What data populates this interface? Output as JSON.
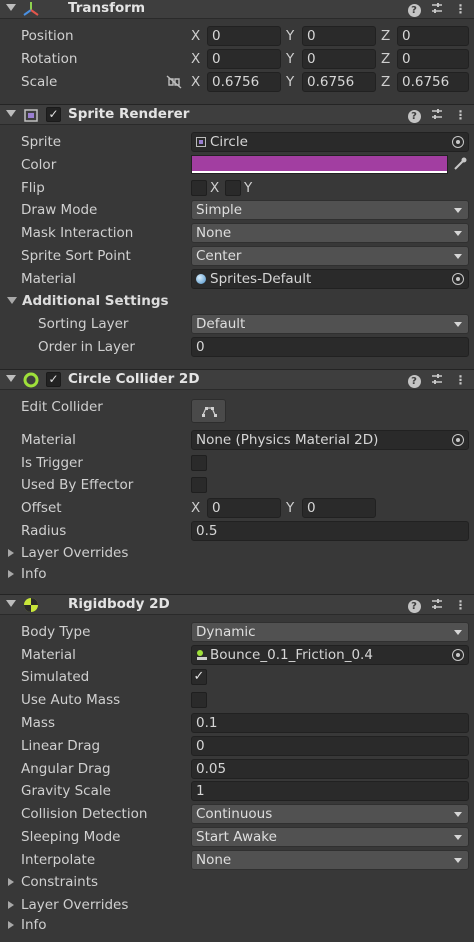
{
  "transform": {
    "title": "Transform",
    "position": {
      "label": "Position",
      "x": "0",
      "y": "0",
      "z": "0"
    },
    "rotation": {
      "label": "Rotation",
      "x": "0",
      "y": "0",
      "z": "0"
    },
    "scale": {
      "label": "Scale",
      "x": "0.6756",
      "y": "0.6756",
      "z": "0.6756"
    }
  },
  "axes": {
    "x": "X",
    "y": "Y",
    "z": "Z"
  },
  "sprite_renderer": {
    "title": "Sprite Renderer",
    "enabled": "✓",
    "sprite": {
      "label": "Sprite",
      "value": "Circle"
    },
    "color": {
      "label": "Color",
      "value": "#a23ea1"
    },
    "flip": {
      "label": "Flip",
      "x": "X",
      "y": "Y"
    },
    "draw_mode": {
      "label": "Draw Mode",
      "value": "Simple"
    },
    "mask_interaction": {
      "label": "Mask Interaction",
      "value": "None"
    },
    "sprite_sort_point": {
      "label": "Sprite Sort Point",
      "value": "Center"
    },
    "material": {
      "label": "Material",
      "value": "Sprites-Default"
    },
    "additional_settings": "Additional Settings",
    "sorting_layer": {
      "label": "Sorting Layer",
      "value": "Default"
    },
    "order_in_layer": {
      "label": "Order in Layer",
      "value": "0"
    }
  },
  "circle_collider": {
    "title": "Circle Collider 2D",
    "enabled": "✓",
    "edit_collider": "Edit Collider",
    "material": {
      "label": "Material",
      "value": "None (Physics Material 2D)"
    },
    "is_trigger": "Is Trigger",
    "used_by_effector": "Used By Effector",
    "offset": {
      "label": "Offset",
      "x": "0",
      "y": "0"
    },
    "radius": {
      "label": "Radius",
      "value": "0.5"
    },
    "layer_overrides": "Layer Overrides",
    "info": "Info"
  },
  "rigidbody": {
    "title": "Rigidbody 2D",
    "body_type": {
      "label": "Body Type",
      "value": "Dynamic"
    },
    "material": {
      "label": "Material",
      "value": "Bounce_0.1_Friction_0.4"
    },
    "simulated": {
      "label": "Simulated",
      "checked": "✓"
    },
    "use_auto_mass": "Use Auto Mass",
    "mass": {
      "label": "Mass",
      "value": "0.1"
    },
    "linear_drag": {
      "label": "Linear Drag",
      "value": "0"
    },
    "angular_drag": {
      "label": "Angular Drag",
      "value": "0.05"
    },
    "gravity_scale": {
      "label": "Gravity Scale",
      "value": "1"
    },
    "collision_detection": {
      "label": "Collision Detection",
      "value": "Continuous"
    },
    "sleeping_mode": {
      "label": "Sleeping Mode",
      "value": "Start Awake"
    },
    "interpolate": {
      "label": "Interpolate",
      "value": "None"
    },
    "constraints": "Constraints",
    "layer_overrides": "Layer Overrides",
    "info": "Info"
  },
  "header_icons": {
    "help": "?",
    "more": "⋮"
  }
}
